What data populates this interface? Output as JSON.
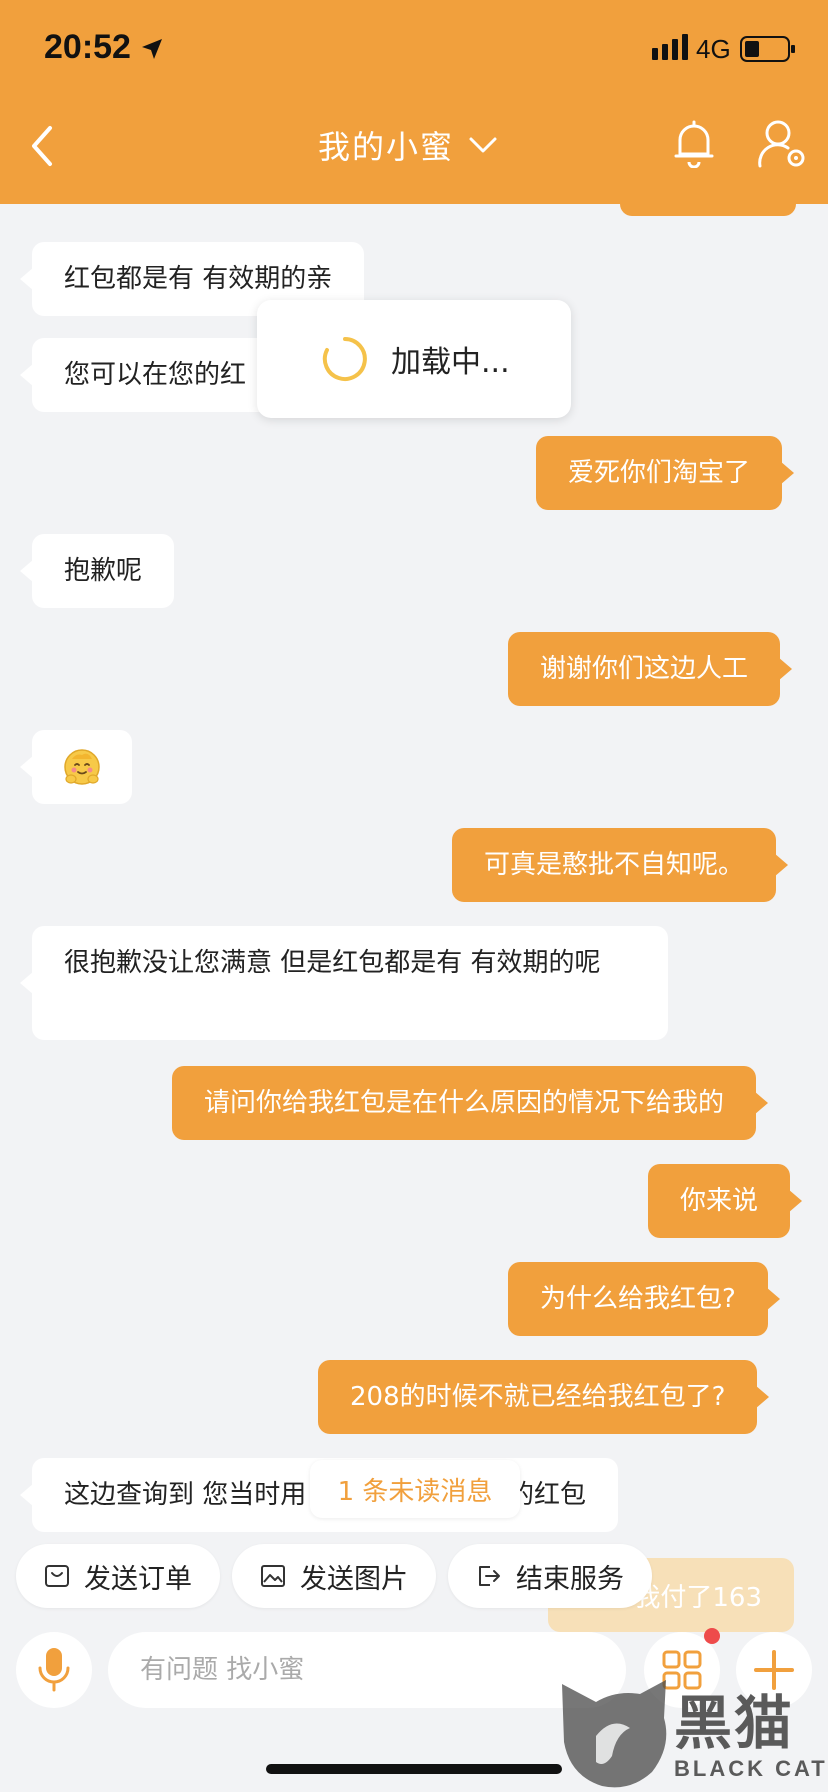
{
  "status_bar": {
    "time": "20:52",
    "network": "4G"
  },
  "header": {
    "title": "我的小蜜"
  },
  "colors": {
    "brand": "#f1a03d",
    "background": "#f2f3f5",
    "badge": "#ee4b4b"
  },
  "messages": [
    {
      "side": "left",
      "text": "红包都是有 有效期的亲"
    },
    {
      "side": "left",
      "text": "您可以在您的红"
    },
    {
      "side": "right",
      "text": "爱死你们淘宝了"
    },
    {
      "side": "left",
      "text": "抱歉呢"
    },
    {
      "side": "right",
      "text": "谢谢你们这边人工"
    },
    {
      "side": "left",
      "emoji": "hugging-face"
    },
    {
      "side": "right",
      "text": "可真是憨批不自知呢。"
    },
    {
      "side": "left",
      "text": "很抱歉没让您满意 但是红包都是有 有效期的呢"
    },
    {
      "side": "right",
      "text": "请问你给我红包是在什么原因的情况下给我的"
    },
    {
      "side": "right",
      "text": "你来说"
    },
    {
      "side": "right",
      "text": "为什么给我红包?"
    },
    {
      "side": "right",
      "text": "208的时候不就已经给我红包了?"
    },
    {
      "side": "left",
      "text": "这边查询到 您当时用"
    },
    {
      "side": "left",
      "text": "的红包"
    },
    {
      "side": "right",
      "text": "我付了163"
    }
  ],
  "loading": {
    "text": "加载中..."
  },
  "unread": {
    "text": "1 条未读消息"
  },
  "quick_actions": [
    {
      "label": "发送订单",
      "icon": "order-icon"
    },
    {
      "label": "发送图片",
      "icon": "image-icon"
    },
    {
      "label": "结束服务",
      "icon": "exit-icon"
    }
  ],
  "input": {
    "placeholder": "有问题 找小蜜"
  },
  "watermark": {
    "main": "黑猫",
    "sub": "BLACK CAT"
  }
}
